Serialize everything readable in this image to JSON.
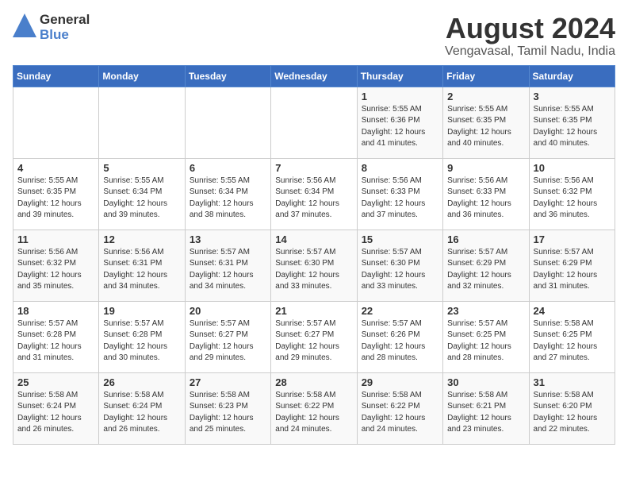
{
  "header": {
    "logo_general": "General",
    "logo_blue": "Blue",
    "month": "August 2024",
    "location": "Vengavasal, Tamil Nadu, India"
  },
  "weekdays": [
    "Sunday",
    "Monday",
    "Tuesday",
    "Wednesday",
    "Thursday",
    "Friday",
    "Saturday"
  ],
  "weeks": [
    [
      {
        "day": "",
        "info": ""
      },
      {
        "day": "",
        "info": ""
      },
      {
        "day": "",
        "info": ""
      },
      {
        "day": "",
        "info": ""
      },
      {
        "day": "1",
        "info": "Sunrise: 5:55 AM\nSunset: 6:36 PM\nDaylight: 12 hours\nand 41 minutes."
      },
      {
        "day": "2",
        "info": "Sunrise: 5:55 AM\nSunset: 6:35 PM\nDaylight: 12 hours\nand 40 minutes."
      },
      {
        "day": "3",
        "info": "Sunrise: 5:55 AM\nSunset: 6:35 PM\nDaylight: 12 hours\nand 40 minutes."
      }
    ],
    [
      {
        "day": "4",
        "info": "Sunrise: 5:55 AM\nSunset: 6:35 PM\nDaylight: 12 hours\nand 39 minutes."
      },
      {
        "day": "5",
        "info": "Sunrise: 5:55 AM\nSunset: 6:34 PM\nDaylight: 12 hours\nand 39 minutes."
      },
      {
        "day": "6",
        "info": "Sunrise: 5:55 AM\nSunset: 6:34 PM\nDaylight: 12 hours\nand 38 minutes."
      },
      {
        "day": "7",
        "info": "Sunrise: 5:56 AM\nSunset: 6:34 PM\nDaylight: 12 hours\nand 37 minutes."
      },
      {
        "day": "8",
        "info": "Sunrise: 5:56 AM\nSunset: 6:33 PM\nDaylight: 12 hours\nand 37 minutes."
      },
      {
        "day": "9",
        "info": "Sunrise: 5:56 AM\nSunset: 6:33 PM\nDaylight: 12 hours\nand 36 minutes."
      },
      {
        "day": "10",
        "info": "Sunrise: 5:56 AM\nSunset: 6:32 PM\nDaylight: 12 hours\nand 36 minutes."
      }
    ],
    [
      {
        "day": "11",
        "info": "Sunrise: 5:56 AM\nSunset: 6:32 PM\nDaylight: 12 hours\nand 35 minutes."
      },
      {
        "day": "12",
        "info": "Sunrise: 5:56 AM\nSunset: 6:31 PM\nDaylight: 12 hours\nand 34 minutes."
      },
      {
        "day": "13",
        "info": "Sunrise: 5:57 AM\nSunset: 6:31 PM\nDaylight: 12 hours\nand 34 minutes."
      },
      {
        "day": "14",
        "info": "Sunrise: 5:57 AM\nSunset: 6:30 PM\nDaylight: 12 hours\nand 33 minutes."
      },
      {
        "day": "15",
        "info": "Sunrise: 5:57 AM\nSunset: 6:30 PM\nDaylight: 12 hours\nand 33 minutes."
      },
      {
        "day": "16",
        "info": "Sunrise: 5:57 AM\nSunset: 6:29 PM\nDaylight: 12 hours\nand 32 minutes."
      },
      {
        "day": "17",
        "info": "Sunrise: 5:57 AM\nSunset: 6:29 PM\nDaylight: 12 hours\nand 31 minutes."
      }
    ],
    [
      {
        "day": "18",
        "info": "Sunrise: 5:57 AM\nSunset: 6:28 PM\nDaylight: 12 hours\nand 31 minutes."
      },
      {
        "day": "19",
        "info": "Sunrise: 5:57 AM\nSunset: 6:28 PM\nDaylight: 12 hours\nand 30 minutes."
      },
      {
        "day": "20",
        "info": "Sunrise: 5:57 AM\nSunset: 6:27 PM\nDaylight: 12 hours\nand 29 minutes."
      },
      {
        "day": "21",
        "info": "Sunrise: 5:57 AM\nSunset: 6:27 PM\nDaylight: 12 hours\nand 29 minutes."
      },
      {
        "day": "22",
        "info": "Sunrise: 5:57 AM\nSunset: 6:26 PM\nDaylight: 12 hours\nand 28 minutes."
      },
      {
        "day": "23",
        "info": "Sunrise: 5:57 AM\nSunset: 6:25 PM\nDaylight: 12 hours\nand 28 minutes."
      },
      {
        "day": "24",
        "info": "Sunrise: 5:58 AM\nSunset: 6:25 PM\nDaylight: 12 hours\nand 27 minutes."
      }
    ],
    [
      {
        "day": "25",
        "info": "Sunrise: 5:58 AM\nSunset: 6:24 PM\nDaylight: 12 hours\nand 26 minutes."
      },
      {
        "day": "26",
        "info": "Sunrise: 5:58 AM\nSunset: 6:24 PM\nDaylight: 12 hours\nand 26 minutes."
      },
      {
        "day": "27",
        "info": "Sunrise: 5:58 AM\nSunset: 6:23 PM\nDaylight: 12 hours\nand 25 minutes."
      },
      {
        "day": "28",
        "info": "Sunrise: 5:58 AM\nSunset: 6:22 PM\nDaylight: 12 hours\nand 24 minutes."
      },
      {
        "day": "29",
        "info": "Sunrise: 5:58 AM\nSunset: 6:22 PM\nDaylight: 12 hours\nand 24 minutes."
      },
      {
        "day": "30",
        "info": "Sunrise: 5:58 AM\nSunset: 6:21 PM\nDaylight: 12 hours\nand 23 minutes."
      },
      {
        "day": "31",
        "info": "Sunrise: 5:58 AM\nSunset: 6:20 PM\nDaylight: 12 hours\nand 22 minutes."
      }
    ]
  ]
}
